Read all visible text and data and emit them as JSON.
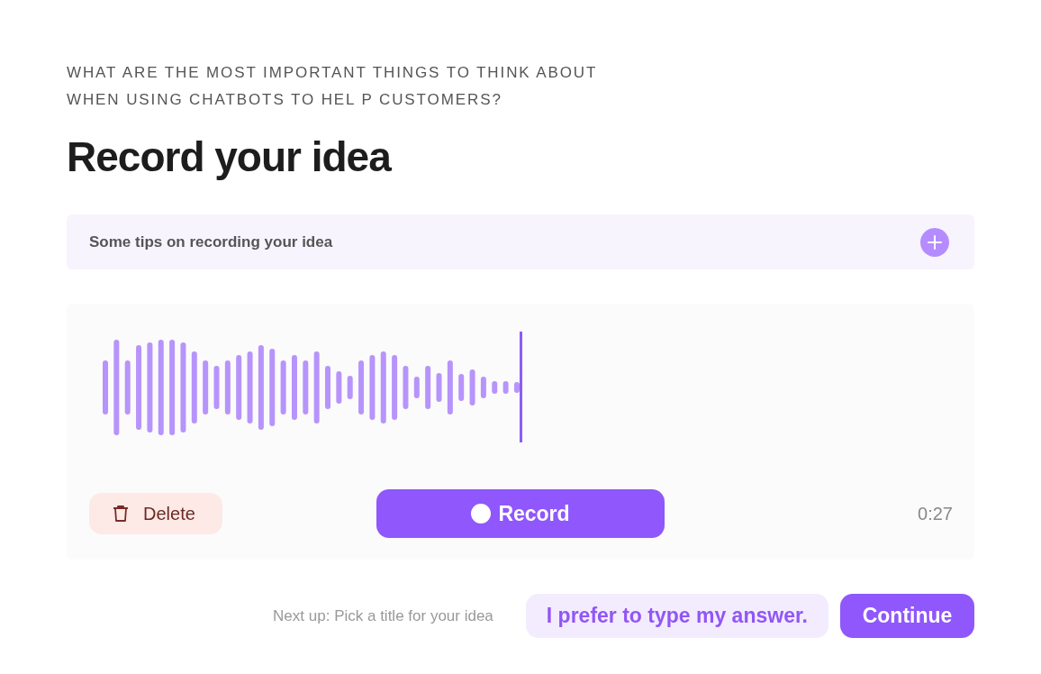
{
  "question": "WHAT ARE THE MOST IMPORTANT THINGS TO THINK ABOUT\nWHEN USING CHATBOTS TO HEL P CUSTOMERS?",
  "title": "Record your idea",
  "tips": {
    "label": "Some tips on recording your idea",
    "expanded": false
  },
  "recorder": {
    "delete_label": "Delete",
    "record_label": "Record",
    "time": "0:27"
  },
  "footer": {
    "next_up": "Next up: Pick a title for your idea",
    "type_button": "I prefer to type my answer.",
    "continue_button": "Continue"
  }
}
